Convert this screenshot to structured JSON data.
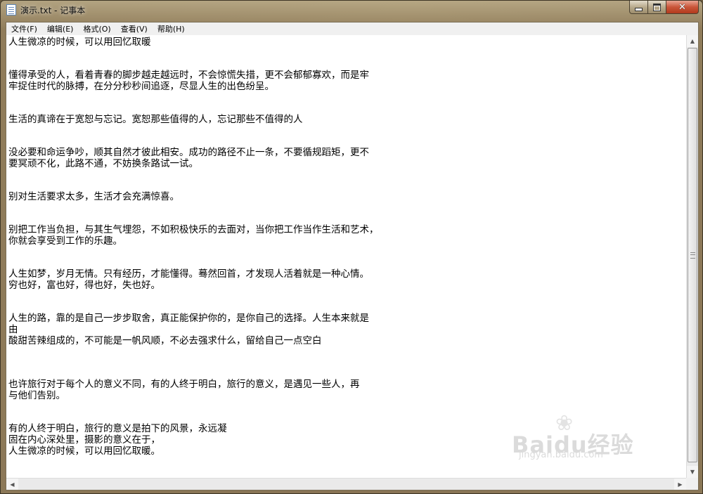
{
  "window": {
    "title": "演示.txt - 记事本",
    "icon": "notepad-icon",
    "controls": {
      "minimize": "minimize-icon",
      "maximize": "maximize-icon",
      "close": "close-icon"
    }
  },
  "menu": {
    "items": [
      {
        "label": "文件(F)"
      },
      {
        "label": "编辑(E)"
      },
      {
        "label": "格式(O)"
      },
      {
        "label": "查看(V)"
      },
      {
        "label": "帮助(H)"
      }
    ]
  },
  "editor": {
    "lines": [
      "人生微凉的时候，可以用回忆取暖",
      "懂得承受的人，看着青春的脚步越走越远时，不会惊慌失措，更不会郁郁寡欢，而是牢",
      "牢捉住时代的脉搏，在分分秒秒间追逐，尽显人生的出色纷呈。",
      "生活的真谛在于宽恕与忘记。宽恕那些值得的人，忘记那些不值得的人",
      "没必要和命运争吵，顺其自然才彼此相安。成功的路径不止一条，不要循规蹈矩，更不",
      "要冥顽不化，此路不通，不妨换条路试一试。",
      "别对生活要求太多，生活才会充满惊喜。",
      "别把工作当负担，与其生气埋怨，不如积极快乐的去面对，当你把工作当作生活和艺术，",
      "你就会享受到工作的乐趣。",
      "人生如梦，岁月无情。只有经历，才能懂得。蓦然回首，才发现人活着就是一种心情。",
      "穷也好，富也好，得也好，失也好。",
      "人生的路，靠的是自己一步步取舍，真正能保护你的，是你自己的选择。人生本来就是",
      "由",
      "酸甜苦辣组成的，不可能是一帆风顺，不必去强求什么，留给自己一点空白",
      "也许旅行对于每个人的意义不同，有的人终于明白，旅行的意义，是遇见一些人，再",
      "与他们告别。",
      "有的人终于明白，旅行的意义是拍下的风景，永远凝",
      "固在内心深处里，摄影的意义在于，",
      "人生微凉的时候，可以用回忆取暖。"
    ]
  },
  "watermark": {
    "brand": "Baidu经验",
    "url": "jingyan.baidu.com"
  }
}
